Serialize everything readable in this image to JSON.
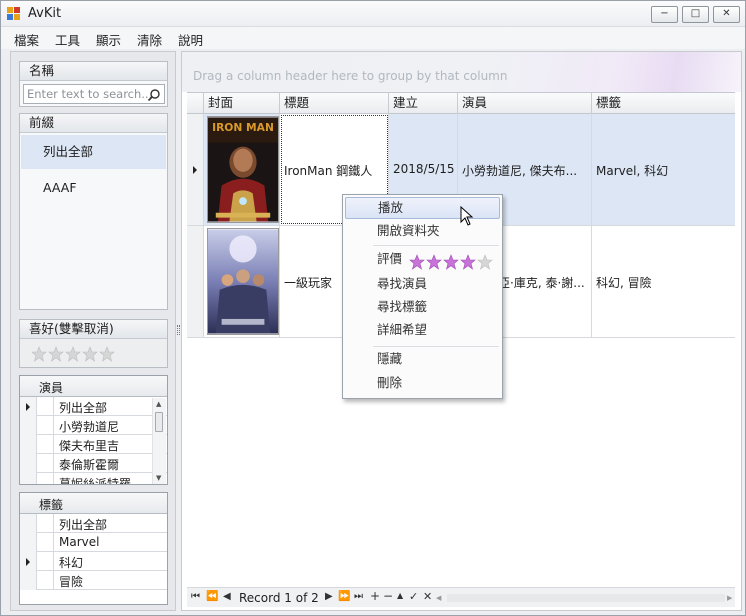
{
  "window": {
    "title": "AvKit",
    "minimize": "−",
    "maximize": "□",
    "close": "✕"
  },
  "menu": [
    "檔案",
    "工具",
    "顯示",
    "清除",
    "說明"
  ],
  "left": {
    "name_group": {
      "title": "名稱",
      "search_placeholder": "Enter text to search..."
    },
    "prefix_group": {
      "title": "前綴",
      "items": [
        "列出全部",
        "AAAF"
      ]
    },
    "fav_group": {
      "title": "喜好(雙擊取消)",
      "rating": 0,
      "max": 5
    },
    "actor_list": {
      "header": "演員",
      "rows": [
        "列出全部",
        "小勞勃道尼",
        "傑夫布里吉",
        "泰倫斯霍爾",
        "葛妮絲派特羅"
      ]
    },
    "tag_list": {
      "header": "標籤",
      "rows": [
        "列出全部",
        "Marvel",
        "科幻",
        "冒險"
      ]
    }
  },
  "grid": {
    "group_hint": "Drag a column header here to group by that column",
    "columns": [
      "封面",
      "標題",
      "建立",
      "演員",
      "標籤"
    ],
    "rows": [
      {
        "title": "IronMan 鋼鐵人",
        "created": "2018/5/15",
        "actors": "小勞勃道尼, 傑夫布...",
        "tags": "Marvel, 科幻",
        "selected": true
      },
      {
        "title": "一級玩家",
        "created": "",
        "actors": "亞·庫克, 泰·謝...",
        "tags": "科幻, 冒險",
        "selected": false
      }
    ],
    "navigator": {
      "record": "Record 1 of 2"
    }
  },
  "context_menu": {
    "items": [
      "播放",
      "開啟資料夾",
      "評價",
      "尋找演員",
      "尋找標籤",
      "詳細希望",
      "隱藏",
      "刪除"
    ],
    "rating": 4,
    "max": 5
  },
  "colors": {
    "selection": "#dce6f5",
    "star_on": "#c873d8",
    "star_off": "#d6d6d6"
  }
}
